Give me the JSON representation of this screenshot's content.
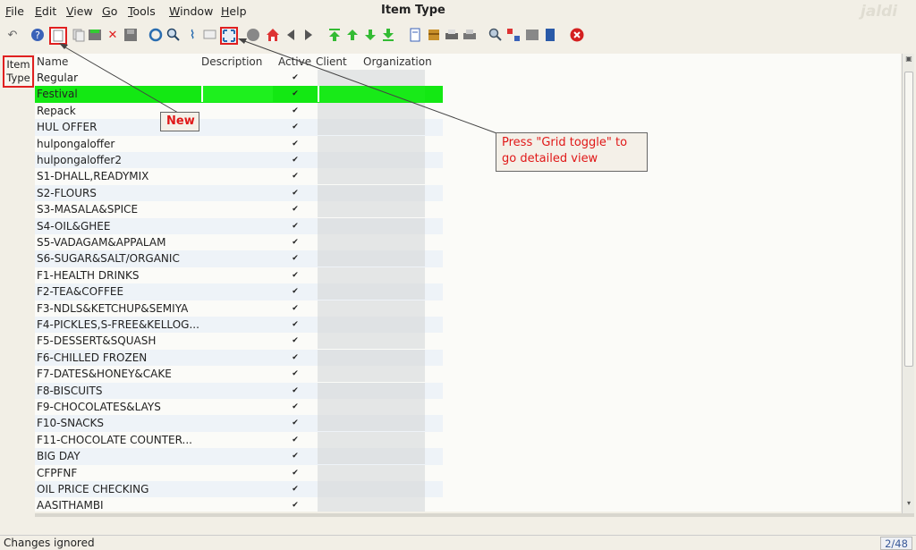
{
  "menu": [
    "File",
    "Edit",
    "View",
    "Go",
    "Tools",
    "Window",
    "Help"
  ],
  "window_title": "Item Type",
  "brand": "jaldi",
  "toolbar_icons": [
    "undo-icon",
    "help-icon",
    "new-record-icon",
    "copy-record-icon",
    "save-icon",
    "delete-icon",
    "save-disk-icon",
    "refresh-icon",
    "find-icon",
    "attachment-icon",
    "chat-icon",
    "grid-toggle-icon",
    "history-icon",
    "home-icon",
    "back-icon",
    "forward-icon",
    "first-record-icon",
    "previous-record-icon",
    "next-record-icon",
    "last-record-icon",
    "report-icon",
    "archive-icon",
    "print-preview-icon",
    "print-icon",
    "zoom-across-icon",
    "workflow-icon",
    "product-info-icon",
    "active-workflows-icon",
    "close-window-icon"
  ],
  "side_tab": "Item Type",
  "columns": {
    "name": "Name",
    "description": "Description",
    "active": "Active",
    "client": "Client",
    "organization": "Organization"
  },
  "rows": [
    {
      "name": "Regular",
      "active": true
    },
    {
      "name": "Festival",
      "active": true,
      "selected": true
    },
    {
      "name": "Repack",
      "active": true
    },
    {
      "name": "HUL OFFER",
      "active": true
    },
    {
      "name": "hulpongaloffer",
      "active": true
    },
    {
      "name": "hulpongaloffer2",
      "active": true
    },
    {
      "name": "S1-DHALL,READYMIX",
      "active": true
    },
    {
      "name": "S2-FLOURS",
      "active": true
    },
    {
      "name": "S3-MASALA&SPICE",
      "active": true
    },
    {
      "name": "S4-OIL&GHEE",
      "active": true
    },
    {
      "name": "S5-VADAGAM&APPALAM",
      "active": true
    },
    {
      "name": "S6-SUGAR&SALT/ORGANIC",
      "active": true
    },
    {
      "name": "F1-HEALTH DRINKS",
      "active": true
    },
    {
      "name": "F2-TEA&COFFEE",
      "active": true
    },
    {
      "name": "F3-NDLS&KETCHUP&SEMIYA",
      "active": true
    },
    {
      "name": "F4-PICKLES,S-FREE&KELLOG...",
      "active": true
    },
    {
      "name": "F5-DESSERT&SQUASH",
      "active": true
    },
    {
      "name": "F6-CHILLED FROZEN",
      "active": true
    },
    {
      "name": "F7-DATES&HONEY&CAKE",
      "active": true
    },
    {
      "name": "F8-BISCUITS",
      "active": true
    },
    {
      "name": "F9-CHOCOLATES&LAYS",
      "active": true
    },
    {
      "name": "F10-SNACKS",
      "active": true
    },
    {
      "name": "F11-CHOCOLATE COUNTER...",
      "active": true
    },
    {
      "name": "BIG DAY",
      "active": true
    },
    {
      "name": "CFPFNF",
      "active": true
    },
    {
      "name": "OIL PRICE CHECKING",
      "active": true
    },
    {
      "name": "AASITHAMBI",
      "active": true
    }
  ],
  "callouts": {
    "new": "New",
    "grid_toggle": "Press \"Grid toggle\" to go detailed view"
  },
  "status": {
    "message": "Changes ignored",
    "record_count": "2/48"
  },
  "colors": {
    "selected_row": "#13e813",
    "callout_text": "#e01818",
    "highlight_border": "#e02020"
  }
}
